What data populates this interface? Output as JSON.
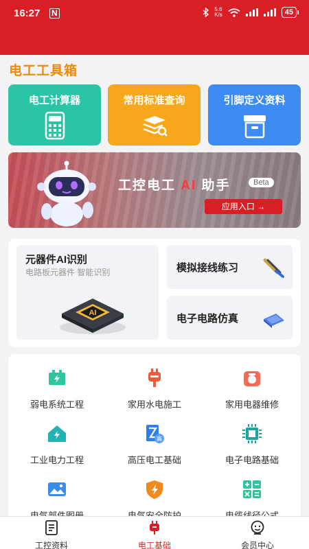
{
  "status_bar": {
    "time": "16:27",
    "nfc": "N",
    "speed_top": "5.6",
    "speed_bottom": "K/s",
    "battery": "45"
  },
  "page_title": "电工工具箱",
  "tiles": [
    {
      "label": "电工计算器",
      "color": "#2ac4a6",
      "icon": "calculator-icon"
    },
    {
      "label": "常用标准查询",
      "color": "#f7a71c",
      "icon": "book-stack-search-icon"
    },
    {
      "label": "引脚定义资料",
      "color": "#3d8cf4",
      "icon": "archive-box-icon"
    }
  ],
  "banner": {
    "title_prefix": "工控电工 ",
    "title_ai": "AI",
    "title_suffix": " 助手",
    "beta": "Beta",
    "button": "应用入口 →"
  },
  "features": {
    "ai_recognition": {
      "title": "元器件AI识别",
      "subtitle": "电路板元器件 智能识别"
    },
    "wiring_practice": {
      "title": "模拟接线练习"
    },
    "circuit_sim": {
      "title": "电子电路仿真"
    }
  },
  "categories": [
    {
      "label": "弱电系统工程",
      "icon": "battery-charge-icon"
    },
    {
      "label": "家用水电施工",
      "icon": "plug-icon"
    },
    {
      "label": "家用电器维修",
      "icon": "rice-cooker-icon"
    },
    {
      "label": "工业电力工程",
      "icon": "factory-icon"
    },
    {
      "label": "高压电工基础",
      "icon": "high-voltage-doc-icon"
    },
    {
      "label": "电子电路基础",
      "icon": "chip-icon"
    },
    {
      "label": "电气部件图册",
      "icon": "image-album-icon"
    },
    {
      "label": "电气安全防护",
      "icon": "shield-bolt-icon"
    },
    {
      "label": "电缆线径公式",
      "icon": "formula-icon"
    }
  ],
  "tabs": [
    {
      "label": "工控资料",
      "icon": "document-icon",
      "active": false
    },
    {
      "label": "电工基础",
      "icon": "plug-icon",
      "active": true
    },
    {
      "label": "会员中心",
      "icon": "user-face-icon",
      "active": false
    }
  ],
  "colors": {
    "brand_red": "#d91e25",
    "title_orange": "#f08a00"
  }
}
